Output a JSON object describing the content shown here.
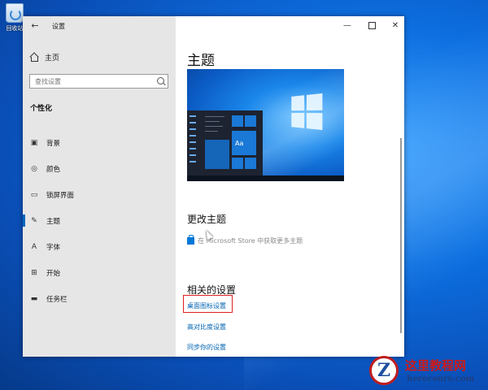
{
  "desktop": {
    "recycle_bin_label": "回收站",
    "wallpaper_accent": "#0d6fe0"
  },
  "window": {
    "title": "设置",
    "back_icon": "back-arrow-icon",
    "controls": {
      "minimize": "—",
      "close": "✕"
    }
  },
  "sidebar": {
    "home_label": "主页",
    "search_placeholder": "查找设置",
    "section_title": "个性化",
    "items": [
      {
        "label": "背景",
        "icon": "image-icon",
        "glyph": "▣",
        "active": false
      },
      {
        "label": "颜色",
        "icon": "palette-icon",
        "glyph": "◎",
        "active": false
      },
      {
        "label": "锁屏界面",
        "icon": "lock-screen-icon",
        "glyph": "▭",
        "active": false
      },
      {
        "label": "主题",
        "icon": "theme-brush-icon",
        "glyph": "✎",
        "active": true
      },
      {
        "label": "字体",
        "icon": "font-icon",
        "glyph": "A",
        "active": false
      },
      {
        "label": "开始",
        "icon": "start-grid-icon",
        "glyph": "⊞",
        "active": false
      },
      {
        "label": "任务栏",
        "icon": "taskbar-icon",
        "glyph": "▬",
        "active": false
      }
    ]
  },
  "main": {
    "title": "主题",
    "preview_tile_text": "Aa",
    "change_theme_title": "更改主题",
    "store_link": "在 Microsoft Store 中获取更多主题",
    "related_title": "相关的设置",
    "related_links": [
      "桌面图标设置",
      "高对比度设置",
      "同步你的设置"
    ],
    "accent_color": "#0063b1"
  },
  "watermark": {
    "site_name": "这里教程网",
    "url": "herecours.com"
  }
}
